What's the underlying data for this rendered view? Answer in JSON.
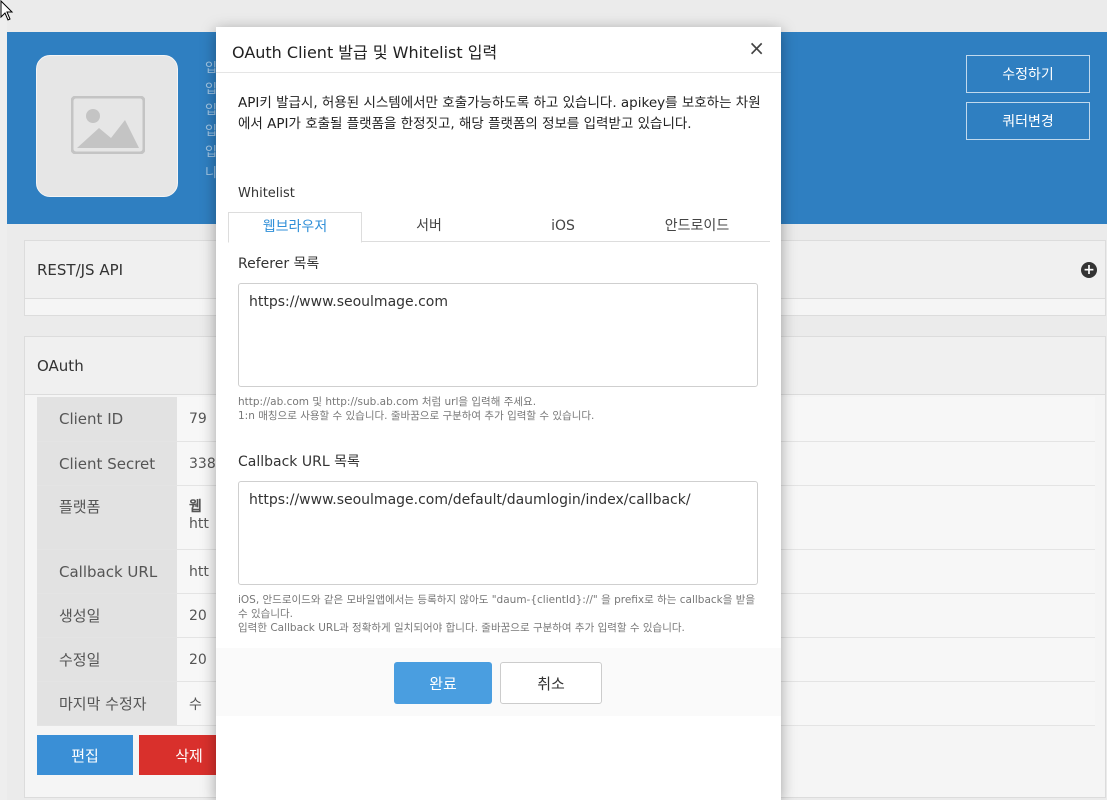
{
  "header": {
    "info_lines": [
      "입",
      "입",
      "입",
      "입",
      "입",
      "니"
    ],
    "edit_button": "수정하기",
    "quota_button": "쿼터변경"
  },
  "rest_panel": {
    "title": "REST/JS API"
  },
  "oauth_panel": {
    "title": "OAuth",
    "rows": [
      {
        "label": "Client ID",
        "value": "79"
      },
      {
        "label": "Client Secret",
        "value": "338"
      },
      {
        "label": "플랫폼",
        "value": "웹",
        "value2": "htt"
      },
      {
        "label": "Callback URL",
        "value": "htt"
      },
      {
        "label": "생성일",
        "value": "20"
      },
      {
        "label": "수정일",
        "value": "20"
      },
      {
        "label": "마지막 수정자",
        "value": "수"
      }
    ],
    "edit_button": "편집",
    "delete_button": "삭제"
  },
  "modal": {
    "title": "OAuth Client 발급 및 Whitelist 입력",
    "close": "×",
    "description": "API키 발급시, 허용된 시스템에서만 호출가능하도록 하고 있습니다. apikey를 보호하는 차원에서 API가 호출될 플랫폼을 한정짓고, 해당 플랫폼의 정보를 입력받고 있습니다.",
    "whitelist_label": "Whitelist",
    "tabs": [
      "웹브라우저",
      "서버",
      "iOS",
      "안드로이드"
    ],
    "referer": {
      "title": "Referer 목록",
      "value": "https://www.seoulmage.com",
      "help1": "http://ab.com 및 http://sub.ab.com 처럼 url을 입력해 주세요.",
      "help2": "1:n 매칭으로 사용할 수 있습니다. 줄바꿈으로 구분하여 추가 입력할 수 있습니다."
    },
    "callback": {
      "title": "Callback URL 목록",
      "value": "https://www.seoulmage.com/default/daumlogin/index/callback/",
      "help1": "iOS, 안드로이드와 같은 모바일앱에서는 등록하지 않아도 \"daum-{clientId}://\" 을 prefix로 하는 callback을 받을 수 있습니다.",
      "help2": "입력한 Callback URL과 정확하게 일치되어야 합니다. 줄바꿈으로 구분하여 추가 입력할 수 있습니다."
    },
    "ok_button": "완료",
    "cancel_button": "취소"
  }
}
